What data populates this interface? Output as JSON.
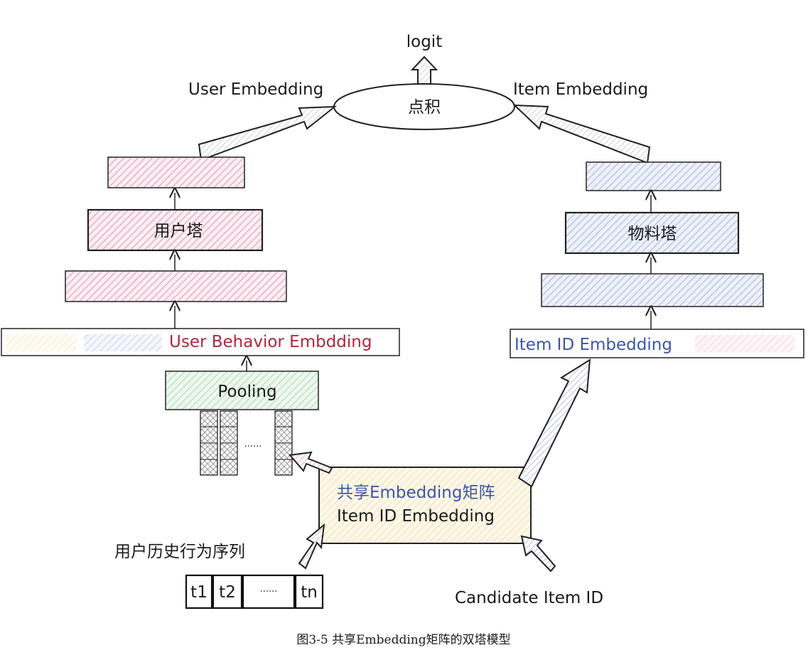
{
  "top": {
    "logit": "logit",
    "dot_product": "点积"
  },
  "user_side": {
    "embedding_label": "User Embedding",
    "tower": "用户塔",
    "behavior_embedding": "User Behavior Embdding",
    "pooling": "Pooling",
    "ellipsis": "......"
  },
  "item_side": {
    "embedding_label": "Item Embedding",
    "tower": "物料塔",
    "id_embedding": "Item ID Embedding"
  },
  "shared": {
    "title": "共享Embedding矩阵",
    "subtitle": "Item ID Embedding"
  },
  "sequence": {
    "label": "用户历史行为序列",
    "cells": [
      "t1",
      "t2",
      "......",
      "tn"
    ]
  },
  "candidate": "Candidate Item ID",
  "caption": "图3-5 共享Embedding矩阵的双塔模型",
  "colors": {
    "user_pink": "#e37a9b",
    "user_text": "#b0263f",
    "item_blue": "#8fa1d6",
    "item_text": "#3b56a8",
    "pooling_green": "#9ccfa6",
    "shared_yellow": "#f0d79b",
    "gray": "#bdbdbd",
    "arrow_red": "#e6a3a3",
    "arrow_blue": "#a6b2d8"
  }
}
